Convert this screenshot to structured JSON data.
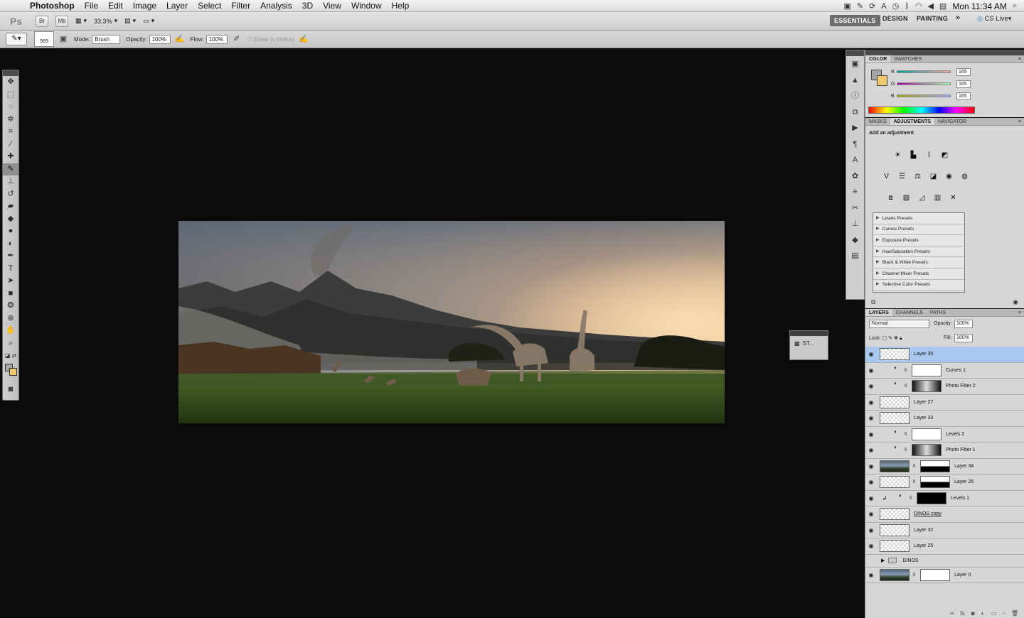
{
  "menubar": {
    "app_name": "Photoshop",
    "items": [
      "File",
      "Edit",
      "Image",
      "Layer",
      "Select",
      "Filter",
      "Analysis",
      "3D",
      "View",
      "Window",
      "Help"
    ],
    "clock": "Mon 11:34 AM"
  },
  "appbar": {
    "logo": "Ps",
    "bridge_btn": "Br",
    "minibridge_btn": "Mb",
    "zoom": "33.3%",
    "workspaces": [
      "ESSENTIALS",
      "DESIGN",
      "PAINTING"
    ],
    "more": "»",
    "cs_live": "CS Live"
  },
  "options": {
    "brush_size": "569",
    "mode_label": "Mode:",
    "mode_value": "Brush",
    "opacity_label": "Opacity:",
    "opacity_value": "100%",
    "flow_label": "Flow:",
    "flow_value": "100%",
    "erase_history": "Erase to History"
  },
  "mini_panel": {
    "label": "ST..."
  },
  "color_panel": {
    "tabs": [
      "COLOR",
      "SWATCHES"
    ],
    "r_label": "R",
    "r_value": "165",
    "g_label": "G",
    "g_value": "165",
    "b_label": "B",
    "b_value": "165",
    "fg_color": "#a5a5a5",
    "bg_color": "#f0c870"
  },
  "adjustments_panel": {
    "tabs": [
      "MASKS",
      "ADJUSTMENTS",
      "NAVIGATOR"
    ],
    "heading": "Add an adjustment",
    "presets": [
      "Levels Presets",
      "Curves Presets",
      "Exposure Presets",
      "Hue/Saturation Presets",
      "Black & White Presets",
      "Channel Mixer Presets",
      "Selective Color Presets"
    ]
  },
  "layers_panel": {
    "tabs": [
      "LAYERS",
      "CHANNELS",
      "PATHS"
    ],
    "blend_mode": "Normal",
    "opacity_label": "Opacity:",
    "opacity_value": "100%",
    "lock_label": "Lock:",
    "fill_label": "Fill:",
    "fill_value": "100%",
    "layers": [
      {
        "name": "Layer 35"
      },
      {
        "name": "Curves 1"
      },
      {
        "name": "Photo Filter 2"
      },
      {
        "name": "Layer 27"
      },
      {
        "name": "Layer 33"
      },
      {
        "name": "Levels 2"
      },
      {
        "name": "Photo Filter 1"
      },
      {
        "name": "Layer 34"
      },
      {
        "name": "Layer 26"
      },
      {
        "name": "Levels 1"
      },
      {
        "name": "DINOS copy"
      },
      {
        "name": "Layer 32"
      },
      {
        "name": "Layer 25"
      },
      {
        "name": "DINOS"
      },
      {
        "name": "Layer 0"
      }
    ]
  }
}
